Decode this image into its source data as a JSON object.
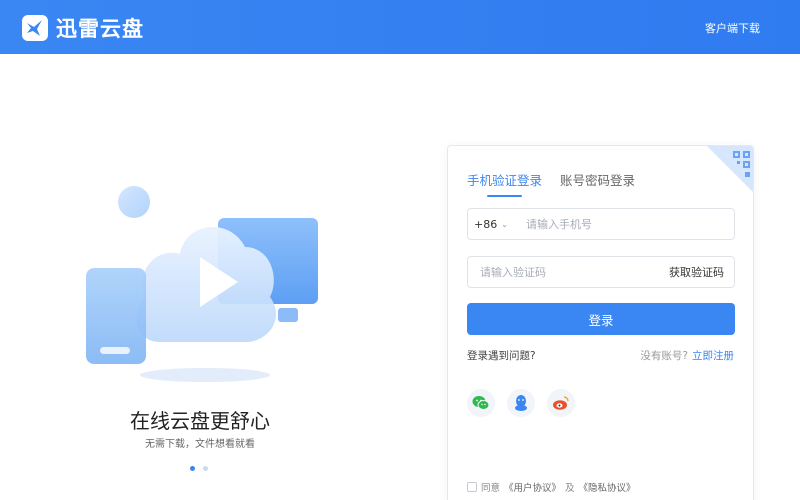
{
  "header": {
    "app_name": "迅雷云盘",
    "client_download": "客户端下载",
    "brand_color": "#3a86f3"
  },
  "promo": {
    "title": "在线云盘更舒心",
    "subtitle": "无需下载，文件想看就看",
    "carousel": {
      "total": 2,
      "active_index": 0
    }
  },
  "login": {
    "tabs": [
      {
        "label": "手机验证登录",
        "active": true
      },
      {
        "label": "账号密码登录",
        "active": false
      }
    ],
    "phone_prefix": "+86",
    "phone_placeholder": "请输入手机号",
    "code_placeholder": "请输入验证码",
    "get_code": "获取验证码",
    "submit": "登录",
    "problem": "登录遇到问题?",
    "no_account": "没有账号?",
    "register": "立即注册",
    "social_icons": [
      "wechat-icon",
      "qq-icon",
      "weibo-icon"
    ],
    "agreement": {
      "prefix": "同意",
      "user_agreement": "《用户协议》",
      "and": "及",
      "privacy_policy": "《隐私协议》"
    }
  }
}
